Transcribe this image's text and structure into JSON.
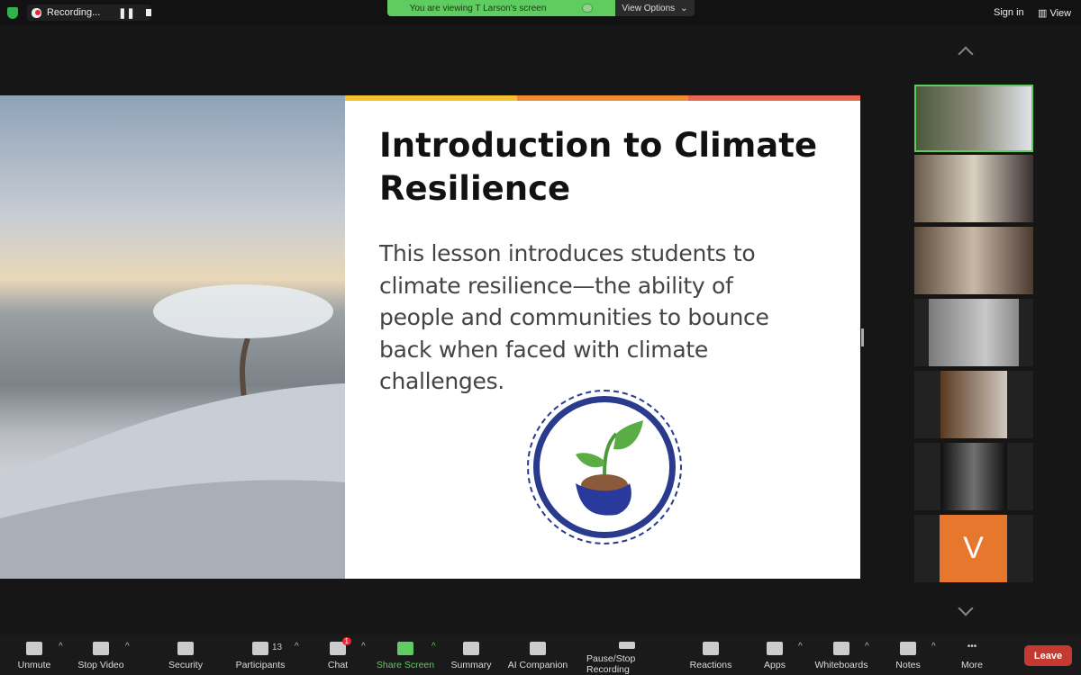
{
  "top_bar": {
    "recording_label": "Recording...",
    "viewing_banner": "You are viewing T Larson's screen",
    "view_options": "View Options",
    "sign_in": "Sign in",
    "view": "View"
  },
  "slide": {
    "title": "Introduction to Climate Resilience",
    "body": "This lesson introduces students to climate resilience—the ability of people and communities to bounce back when faced with climate challenges.",
    "accent_colors": [
      "#f5c12e",
      "#ef8c34",
      "#e86652"
    ]
  },
  "participants_gallery": [
    {
      "initial": ""
    },
    {
      "initial": ""
    },
    {
      "initial": ""
    },
    {
      "initial": ""
    },
    {
      "initial": ""
    },
    {
      "initial": ""
    },
    {
      "initial": "V",
      "color": "#e8772e"
    }
  ],
  "toolbar": {
    "items": [
      {
        "label": "Unmute",
        "icon": "microphone-muted-icon"
      },
      {
        "label": "Stop Video",
        "icon": "video-camera-icon"
      },
      {
        "label": "Security",
        "icon": "shield-icon"
      },
      {
        "label": "Participants",
        "icon": "participants-icon",
        "count": "13"
      },
      {
        "label": "Chat",
        "icon": "chat-icon",
        "badge": "1"
      },
      {
        "label": "Share Screen",
        "icon": "share-screen-icon"
      },
      {
        "label": "Summary",
        "icon": "summary-icon"
      },
      {
        "label": "AI Companion",
        "icon": "sparkle-icon"
      },
      {
        "label": "Pause/Stop Recording",
        "icon": "pause-stop-icon"
      },
      {
        "label": "Reactions",
        "icon": "reaction-icon"
      },
      {
        "label": "Apps",
        "icon": "apps-icon"
      },
      {
        "label": "Whiteboards",
        "icon": "whiteboard-icon"
      },
      {
        "label": "Notes",
        "icon": "notes-icon"
      },
      {
        "label": "More",
        "icon": "more-icon"
      }
    ],
    "leave": "Leave"
  }
}
